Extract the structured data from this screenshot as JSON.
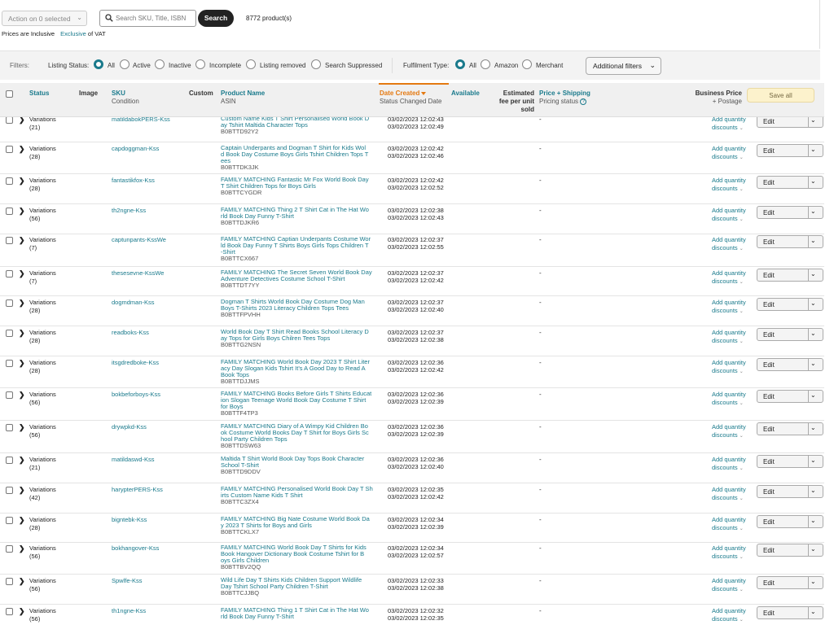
{
  "toolbar": {
    "action_label": "Action on 0 selected",
    "search_placeholder": "Search SKU, Title, ISBN",
    "search_value": "",
    "search_button": "Search",
    "product_count": "8772 product(s)"
  },
  "vat": {
    "prefix": "Prices are",
    "inclusive": "Inclusive",
    "exclusive_link": "Exclusive",
    "suffix": "of VAT"
  },
  "filters": {
    "label": "Filters:",
    "listing_status_label": "Listing Status:",
    "listing_status_options": [
      "All",
      "Active",
      "Inactive",
      "Incomplete",
      "Listing removed",
      "Search Suppressed"
    ],
    "listing_status_selected": "All",
    "fulfilment_label": "Fulfilment Type:",
    "fulfilment_options": [
      "All",
      "Amazon",
      "Merchant"
    ],
    "fulfilment_selected": "All",
    "additional_filters": "Additional filters"
  },
  "table": {
    "headers": {
      "status": "Status",
      "image": "Image",
      "sku": "SKU",
      "sku_sub": "Condition",
      "custom": "Custom",
      "product_name": "Product Name",
      "product_name_sub": "ASIN",
      "date_created": "Date Created",
      "date_created_sub": "Status Changed Date",
      "available": "Available",
      "estimated_fee": "Estimated\nfee per unit\nsold",
      "price_shipping": "Price + Shipping",
      "price_shipping_sub": "Pricing status",
      "business_price": "Business Price",
      "business_price_sub": "+ Postage",
      "save_all": "Save all"
    },
    "row_labels": {
      "variations": "Variations",
      "add_quantity_1": "Add quantity",
      "add_quantity_2": "discounts",
      "edit": "Edit",
      "dash": "-"
    },
    "rows": [
      {
        "count": "(21)",
        "sku": "matildabokPERS-Kss",
        "name": "Custom Name Kids T Shirt Personalised World Book D\nay Tshirt Maltida Character Tops",
        "asin": "B0BTTD92Y2",
        "created": "03/02/2023 12:02:43",
        "changed": "03/02/2023 12:02:49"
      },
      {
        "count": "(28)",
        "sku": "capdoggman-Kss",
        "name": "Captain Underpants and Dogman T Shirt for Kids Wol\nd Book Day Costume Boys Girls Tshirt Children Tops T\nees",
        "asin": "B0BTTDK3JK",
        "created": "03/02/2023 12:02:42",
        "changed": "03/02/2023 12:02:46"
      },
      {
        "count": "(28)",
        "sku": "fantastikfox-Kss",
        "name": "FAMILY MATCHING Fantastic Mr Fox World Book Day\nT Shirt Children Tops for Boys Girls",
        "asin": "B0BTTCYGDR",
        "created": "03/02/2023 12:02:42",
        "changed": "03/02/2023 12:02:52"
      },
      {
        "count": "(56)",
        "sku": "th2ngne-Kss",
        "name": "FAMILY MATCHING Thing 2 T Shirt Cat in The Hat Wo\nrld Book Day Funny T-Shirt",
        "asin": "B0BTTDJKR6",
        "created": "03/02/2023 12:02:38",
        "changed": "03/02/2023 12:02:43"
      },
      {
        "count": "(7)",
        "sku": "captunpants-KssWe",
        "name": "FAMILY MATCHING Captian Underpants Costume Wor\nld Book Day Funny T Shirts Boys Girls Tops Children T\n-Shirt",
        "asin": "B0BTTCX667",
        "created": "03/02/2023 12:02:37",
        "changed": "03/02/2023 12:02:55"
      },
      {
        "count": "(7)",
        "sku": "thesesevne-KssWe",
        "name": "FAMILY MATCHING The Secret Seven World Book Day\nAdventure Detectives Costume School T-Shirt",
        "asin": "B0BTTDT7YY",
        "created": "03/02/2023 12:02:37",
        "changed": "03/02/2023 12:02:42"
      },
      {
        "count": "(28)",
        "sku": "dogmdman-Kss",
        "name": "Dogman T Shirts World Book Day Costume Dog Man\nBoys T-Shirts 2023 Literacy Children Tops Tees",
        "asin": "B0BTTFPVHH",
        "created": "03/02/2023 12:02:37",
        "changed": "03/02/2023 12:02:40"
      },
      {
        "count": "(28)",
        "sku": "readboks-Kss",
        "name": "World Book Day T Shirt Read Books School Literacy D\nay Tops for Girls Boys Chilren Tees Tops",
        "asin": "B0BTTG2NSN",
        "created": "03/02/2023 12:02:37",
        "changed": "03/02/2023 12:02:38"
      },
      {
        "count": "(28)",
        "sku": "itsgdredboke-Kss",
        "name": "FAMILY MATCHING World Book Day 2023 T Shirt Liter\nacy Day Slogan Kids Tshirt It's A Good Day to Read A\nBook Tops",
        "asin": "B0BTTDJJMS",
        "created": "03/02/2023 12:02:36",
        "changed": "03/02/2023 12:02:42"
      },
      {
        "count": "(56)",
        "sku": "bokbeforboys-Kss",
        "name": "FAMILY MATCHING Books Before Girls T Shirts Educat\nion Slogan Teenage World Book Day Costume T Shirt\nfor Boys",
        "asin": "B0BTTF4TP3",
        "created": "03/02/2023 12:02:36",
        "changed": "03/02/2023 12:02:39"
      },
      {
        "count": "(56)",
        "sku": "drywpkd-Kss",
        "name": "FAMILY MATCHING Diary of A Wimpy Kid Children Bo\nok Costume World Books Day T Shirt for Boys Girls Sc\nhool Party Children Tops",
        "asin": "B0BTTDSW63",
        "created": "03/02/2023 12:02:36",
        "changed": "03/02/2023 12:02:39"
      },
      {
        "count": "(21)",
        "sku": "matildaswd-Kss",
        "name": "Maltida T Shirt World Book Day Tops Book Character\nSchool T-Shirt",
        "asin": "B0BTTD9DDV",
        "created": "03/02/2023 12:02:36",
        "changed": "03/02/2023 12:02:40"
      },
      {
        "count": "(42)",
        "sku": "harypterPERS-Kss",
        "name": "FAMILY MATCHING Personalised World Book Day T Sh\nirts Custom Name Kids T Shirt",
        "asin": "B0BTTC3ZX4",
        "created": "03/02/2023 12:02:35",
        "changed": "03/02/2023 12:02:42"
      },
      {
        "count": "(28)",
        "sku": "bigntebk-Kss",
        "name": "FAMILY MATCHING Big Nate Costume World Book Da\ny 2023 T Shirts for Boys and Girls",
        "asin": "B0BTTCKLX7",
        "created": "03/02/2023 12:02:34",
        "changed": "03/02/2023 12:02:39"
      },
      {
        "count": "(56)",
        "sku": "bokhangover-Kss",
        "name": "FAMILY MATCHING World Book Day T Shirts for Kids\nBook Hangover Dictionary Book Costume Tshirt for B\noys Girls Children",
        "asin": "B0BTTBV2QQ",
        "created": "03/02/2023 12:02:34",
        "changed": "03/02/2023 12:02:57"
      },
      {
        "count": "(56)",
        "sku": "Spwlfe-Kss",
        "name": "Wild Life Day T Shirts Kids Children Support Wildlife\nDay Tshirt School Party Children T-Shirt",
        "asin": "B0BTTCJJBQ",
        "created": "03/02/2023 12:02:33",
        "changed": "03/02/2023 12:02:38"
      },
      {
        "count": "(56)",
        "sku": "th1ngne-Kss",
        "name": "FAMILY MATCHING Thing 1 T Shirt Cat in The Hat Wo\nrld Book Day Funny T-Shirt",
        "asin": "",
        "created": "03/02/2023 12:02:32",
        "changed": "03/02/2023 12:02:35"
      }
    ]
  },
  "colors": {
    "link": "#1a7a8c",
    "sort_accent": "#e47911",
    "save_all_bg": "#fcf2cc",
    "search_button_bg": "#222222"
  }
}
